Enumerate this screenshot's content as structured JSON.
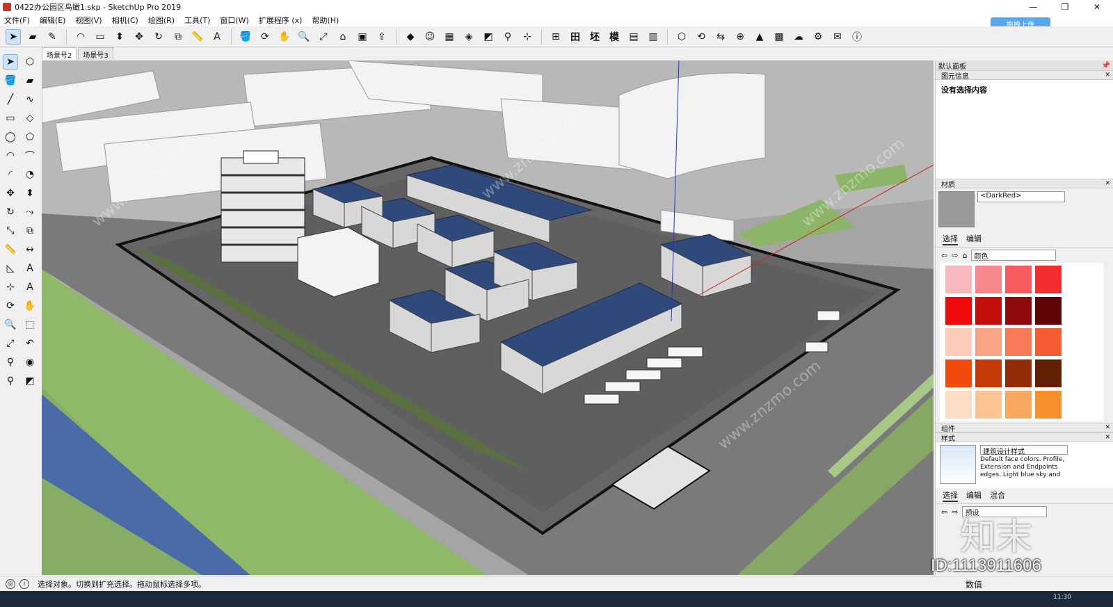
{
  "window": {
    "title": "0422办公园区鸟瞰1.skp - SketchUp Pro 2019",
    "controls": [
      "—",
      "❐",
      "✕"
    ]
  },
  "menu": [
    "文件(F)",
    "编辑(E)",
    "视图(V)",
    "相机(C)",
    "绘图(R)",
    "工具(T)",
    "窗口(W)",
    "扩展程序 (x)",
    "帮助(H)"
  ],
  "upload_button": "拖拽上传",
  "toolbar_icons": [
    "select-icon",
    "eraser-icon",
    "pencil-icon",
    "arc-icon",
    "rectangle-icon",
    "push-pull-icon",
    "move-icon",
    "rotate-icon",
    "offset-icon",
    "tape-icon",
    "text-icon",
    "paint-icon",
    "orbit-icon",
    "pan-icon",
    "zoom-icon",
    "zoom-extents-icon",
    "warehouse-icon",
    "extension-icon",
    "share-icon",
    "ruby-icon",
    "user-icon",
    "sandbox-icon",
    "terrain-icon",
    "section-icon",
    "walk-icon",
    "axes-icon",
    "table-icon",
    "layout-icon",
    "model-icon",
    "plugin-icon",
    "refresh-icon",
    "export-icon",
    "plus-icon",
    "tree-icon",
    "checker-icon",
    "cloud-icon",
    "gear-icon",
    "mail-icon",
    "info-icon"
  ],
  "toolbar_text_icons": {
    "t1": "田",
    "t2": "坯",
    "t3": "模"
  },
  "scene_tabs": [
    "场景号2",
    "场景号3"
  ],
  "left_tools": [
    "select-icon",
    "component-icon",
    "paint-icon",
    "eraser-icon",
    "line-icon",
    "freehand-icon",
    "rectangle-icon",
    "rotated-rect-icon",
    "circle-icon",
    "polygon-icon",
    "arc-icon",
    "arc2-icon",
    "arc3-icon",
    "pie-icon",
    "move-icon",
    "push-pull-icon",
    "rotate-icon",
    "follow-me-icon",
    "scale-icon",
    "offset-icon",
    "tape-icon",
    "dimension-icon",
    "protractor-icon",
    "text-icon",
    "axes-icon",
    "3d-text-icon",
    "orbit-icon",
    "pan-icon",
    "zoom-icon",
    "zoom-window-icon",
    "zoom-extents-icon",
    "previous-icon",
    "position-camera-icon",
    "look-around-icon",
    "walk-icon",
    "section-icon"
  ],
  "status": {
    "message": "选择对象。切换到扩充选择。拖动鼠标选择多项。",
    "measure_label": "数值"
  },
  "panel": {
    "title": "默认面板",
    "entity": {
      "head": "图元信息",
      "body": "没有选择内容"
    },
    "materials": {
      "head": "材质",
      "name": "<DarkRed>",
      "tabs": [
        "选择",
        "编辑"
      ],
      "library": "颜色",
      "swatches": [
        "#f7b9bb",
        "#f7898c",
        "#f55b5d",
        "#f22d2f",
        "#ef0b0b",
        "#c40e0e",
        "#8f0a0a",
        "#5e0606",
        "#fbcbb8",
        "#f9a387",
        "#f77a57",
        "#f45a2f",
        "#f14a0c",
        "#c43b09",
        "#932c06",
        "#612003",
        "#fcdcc2",
        "#fbc490",
        "#f9a95f",
        "#f78f2f",
        "#f27f0c"
      ]
    },
    "components": {
      "head": "组件"
    },
    "styles": {
      "head": "样式",
      "name": "建筑设计样式",
      "description": "Default face colors. Profile, Extension and Endpoints edges. Light blue sky and",
      "tabs": [
        "选择",
        "编辑",
        "混合"
      ],
      "library": "预设"
    }
  },
  "watermark": {
    "id": "ID:1113911606",
    "logo": "知末",
    "repeat": "www.znzmo.com"
  },
  "clock": "11:30"
}
